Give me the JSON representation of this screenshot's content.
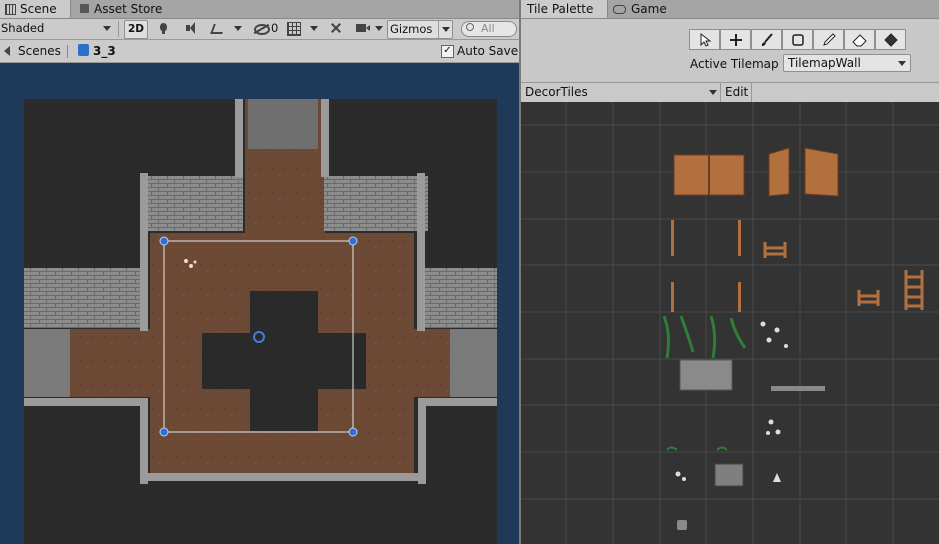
{
  "left_tabs": {
    "scene": "Scene",
    "asset_store": "Asset Store"
  },
  "toolbar": {
    "draw_mode": "Shaded",
    "mode_2d": "2D",
    "hidden_count": "0",
    "gizmos": "Gizmos",
    "search_placeholder": "All"
  },
  "breadcrumb": {
    "scenes": "Scenes",
    "scene_name": "3_3",
    "auto_save": "Auto Save"
  },
  "right_tabs": {
    "tile_palette": "Tile Palette",
    "game": "Game"
  },
  "palette": {
    "active_tilemap_label": "Active Tilemap",
    "active_tilemap_value": "TilemapWall",
    "palette_name": "DecorTiles",
    "edit_label": "Edit"
  },
  "icons": {
    "tools": [
      "select-icon",
      "move-icon",
      "brush-icon",
      "box-fill-icon",
      "picker-icon",
      "eraser-icon",
      "fill-icon"
    ]
  },
  "colors": {
    "scene_bg": "#1e3a58",
    "floor": "#6e4a33",
    "wall": "#8f8f8f",
    "void": "#2b2b2b",
    "grid_bg": "#333333",
    "selection_handle": "#2f6fd6"
  }
}
